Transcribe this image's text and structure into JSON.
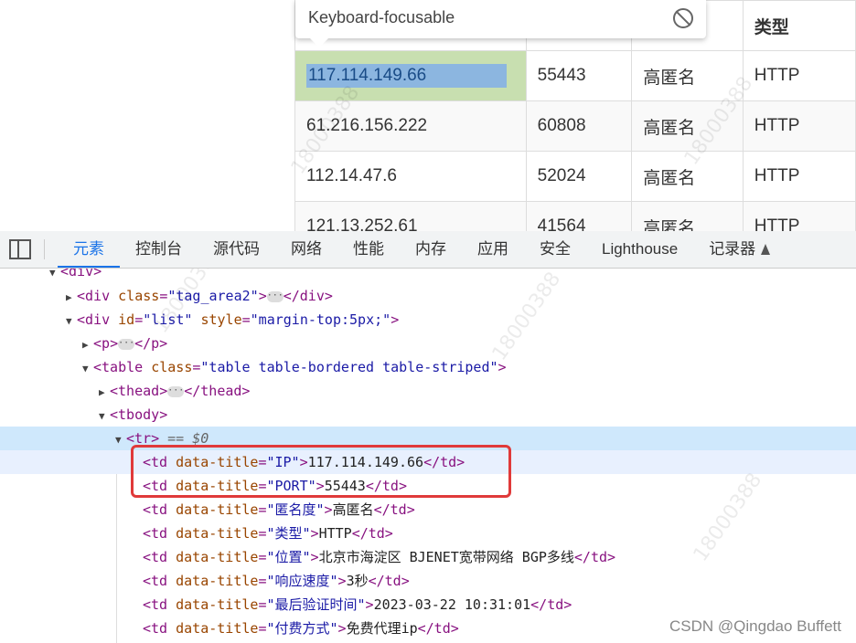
{
  "tooltip": {
    "text": "Keyboard-focusable"
  },
  "page_table": {
    "header_type": "类型",
    "rows": [
      {
        "ip": "117.114.149.66",
        "port": "55443",
        "anon": "高匿名",
        "type": "HTTP"
      },
      {
        "ip": "61.216.156.222",
        "port": "60808",
        "anon": "高匿名",
        "type": "HTTP"
      },
      {
        "ip": "112.14.47.6",
        "port": "52024",
        "anon": "高匿名",
        "type": "HTTP"
      },
      {
        "ip": "121.13.252.61",
        "port": "41564",
        "anon": "高匿名",
        "type": "HTTP"
      }
    ]
  },
  "devtools": {
    "tabs": [
      "元素",
      "控制台",
      "源代码",
      "网络",
      "性能",
      "内存",
      "应用",
      "安全",
      "Lighthouse",
      "记录器"
    ],
    "active_tab": "元素"
  },
  "dom": {
    "l0": "<div>",
    "l1_tag": "div",
    "l1_attr": "class",
    "l1_val": "\"tag_area2\"",
    "l2_tag": "div",
    "l2_attr1": "id",
    "l2_val1": "\"list\"",
    "l2_attr2": "style",
    "l2_val2": "\"margin-top:5px;\"",
    "l3_tag": "p",
    "l4_tag": "table",
    "l4_attr": "class",
    "l4_val": "\"table table-bordered table-striped\"",
    "l5_tag": "thead",
    "l6_tag": "tbody",
    "l7_tag": "tr",
    "l7_eq": "== $0",
    "cells": [
      {
        "title": "\"IP\"",
        "text": "117.114.149.66"
      },
      {
        "title": "\"PORT\"",
        "text": "55443"
      },
      {
        "title": "\"匿名度\"",
        "text": "高匿名"
      },
      {
        "title": "\"类型\"",
        "text": "HTTP"
      },
      {
        "title": "\"位置\"",
        "text": "北京市海淀区 BJENET宽带网络 BGP多线"
      },
      {
        "title": "\"响应速度\"",
        "text": "3秒"
      },
      {
        "title": "\"最后验证时间\"",
        "text": "2023-03-22 10:31:01"
      },
      {
        "title": "\"付费方式\"",
        "text": "免费代理ip"
      }
    ]
  },
  "watermark": "18000388",
  "credit": "CSDN @Qingdao Buffett"
}
